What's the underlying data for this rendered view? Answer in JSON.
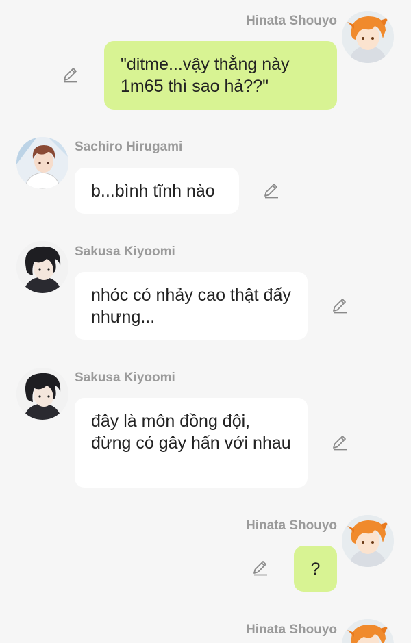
{
  "messages": [
    {
      "sender": "Hinata Shouyo",
      "text": "\"ditme...vậy thằng này 1m65 thì sao hả??\"",
      "side": "right"
    },
    {
      "sender": "Sachiro Hirugami",
      "text": "b...bình tĩnh nào",
      "side": "left"
    },
    {
      "sender": "Sakusa Kiyoomi",
      "text": "nhóc có nhảy cao thật đấy nhưng...",
      "side": "left"
    },
    {
      "sender": "Sakusa Kiyoomi",
      "text": "đây là môn đồng đội, đừng có gây hấn với nhau",
      "side": "left"
    },
    {
      "sender": "Hinata Shouyo",
      "text": "?",
      "side": "right"
    },
    {
      "sender": "Hinata Shouyo",
      "text": "",
      "side": "right"
    }
  ],
  "colors": {
    "background": "#f6f6f6",
    "my_bubble": "#d8f393",
    "other_bubble": "#ffffff",
    "name_text": "#9a9a9a",
    "hinata_hair": "#f08a2c",
    "dark_hair": "#1e1e22",
    "sachiro_hair": "#8a4a35"
  },
  "icons": {
    "edit": "pencil-edit-icon"
  }
}
